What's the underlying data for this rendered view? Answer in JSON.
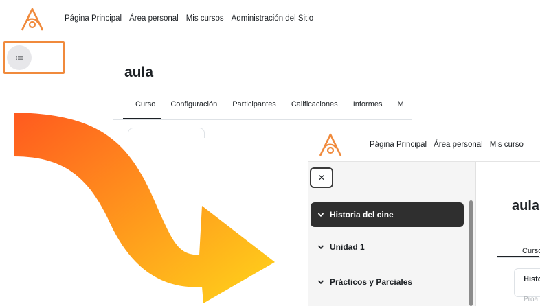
{
  "colors": {
    "brand_logo": "#f08a3c",
    "highlight": "#f08a3c",
    "arrow_start": "#ff5a1f",
    "arrow_end": "#ffd51a",
    "active_section_bg": "#2f2f2f"
  },
  "before": {
    "nav": {
      "logo_icon": "moodle-style-a-logo-icon",
      "links": [
        "Página Principal",
        "Área personal",
        "Mis cursos",
        "Administración del Sitio"
      ]
    },
    "drawer_toggle_icon": "list-icon",
    "course_title": "aula",
    "tabs": [
      "Curso",
      "Configuración",
      "Participantes",
      "Calificaciones",
      "Informes",
      "M"
    ]
  },
  "after": {
    "nav": {
      "logo_icon": "moodle-style-a-logo-icon",
      "links": [
        "Página Principal",
        "Área personal",
        "Mis curso"
      ]
    },
    "close_icon": "close-icon",
    "sections": [
      {
        "label": "Historia del cine",
        "active": true
      },
      {
        "label": "Unidad 1",
        "active": false
      },
      {
        "label": "Prácticos y Parciales",
        "active": false
      }
    ],
    "course_title": "aula",
    "active_tab": "Curso",
    "card_title": "Histo",
    "card_sub": "Proa"
  }
}
